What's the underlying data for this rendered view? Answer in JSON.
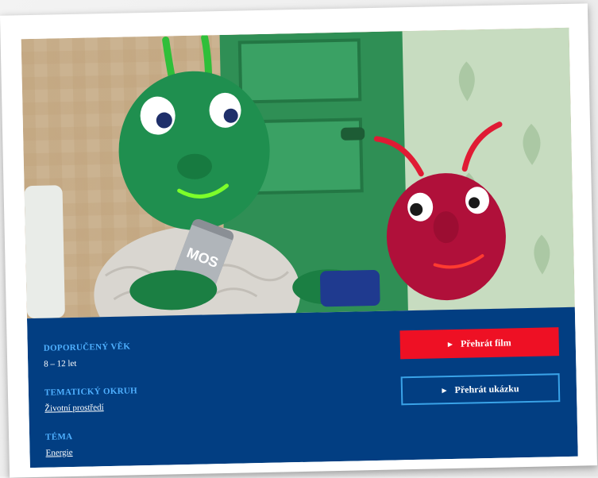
{
  "metadata": {
    "age": {
      "label": "DOPORUČENÝ VĚK",
      "value": "8 – 12 let"
    },
    "topic": {
      "label": "TEMATICKÝ OKRUH",
      "value": "Životní prostředí"
    },
    "theme": {
      "label": "TÉMA",
      "value": "Energie"
    }
  },
  "actions": {
    "play_film": "Přehrát film",
    "play_trailer": "Přehrát ukázku"
  },
  "still_image": {
    "can_text": "MOS",
    "colors": {
      "panel": "#023e82",
      "label": "#4fb0ff",
      "primary_button": "#ee1024",
      "secondary_border": "#3aa3e8"
    }
  }
}
